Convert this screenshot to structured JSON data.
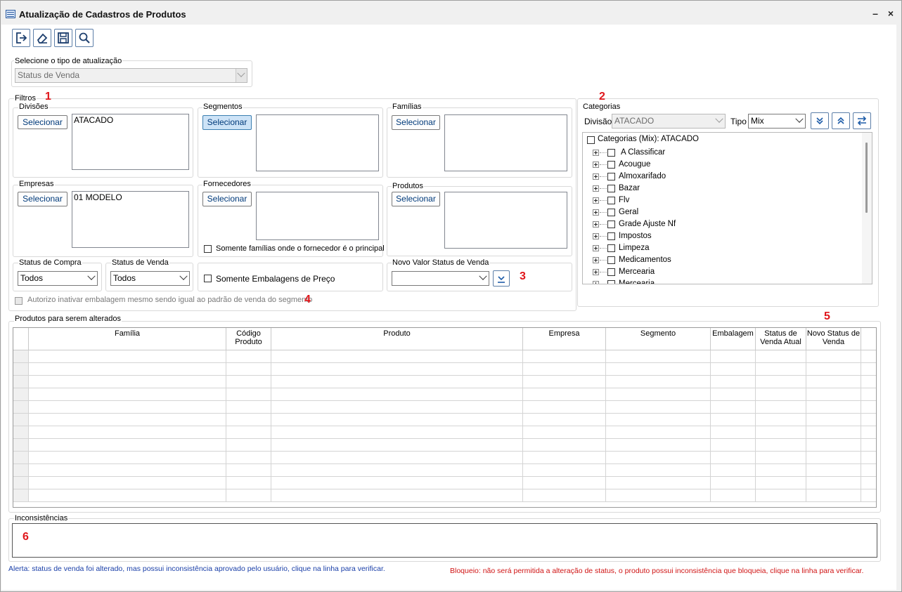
{
  "window": {
    "title": "Atualização de Cadastros de Produtos",
    "minimize": "–",
    "close": "×"
  },
  "toolbar": {
    "exit_icon": "exit-icon",
    "clear_icon": "eraser-icon",
    "save_icon": "save-icon",
    "search_icon": "search-icon"
  },
  "update_type": {
    "label": "Selecione o tipo de atualização",
    "value": "Status de Venda"
  },
  "filters": {
    "label": "Filtros",
    "marker": "1",
    "divisoes": {
      "label": "Divisões",
      "button": "Selecionar",
      "items": "ATACADO"
    },
    "segmentos": {
      "label": "Segmentos",
      "button": "Selecionar",
      "items": ""
    },
    "familias": {
      "label": "Famílias",
      "button": "Selecionar",
      "items": ""
    },
    "empresas": {
      "label": "Empresas",
      "button": "Selecionar",
      "items": "01 MODELO"
    },
    "fornecedores": {
      "label": "Fornecedores",
      "button": "Selecionar",
      "items": "",
      "checkbox": "Somente famílias onde o fornecedor é o principal"
    },
    "produtos": {
      "label": "Produtos",
      "button": "Selecionar",
      "items": ""
    },
    "status_compra": {
      "label": "Status de Compra",
      "value": "Todos"
    },
    "status_venda": {
      "label": "Status de Venda",
      "value": "Todos"
    },
    "embalagens": {
      "checkbox": "Somente Embalagens de Preço"
    },
    "novo_valor": {
      "label": "Novo Valor Status de Venda",
      "value": "",
      "marker": "3"
    },
    "autorizo": {
      "text": "Autorizo inativar embalagem mesmo sendo igual ao padrão de venda do segmento",
      "marker": "4"
    }
  },
  "categorias": {
    "label": "Categorias",
    "marker": "2",
    "divisao_label": "Divisão",
    "divisao_value": "ATACADO",
    "tipo_label": "Tipo",
    "tipo_value": "Mix",
    "root": "Categorias (Mix): ATACADO",
    "items": [
      "A Classificar",
      "Acougue",
      "Almoxarifado",
      "Bazar",
      "Flv",
      "Geral",
      "Grade Ajuste Nf",
      "Impostos",
      "Limpeza",
      "Medicamentos",
      "Mercearia",
      "Mercearia"
    ]
  },
  "produtos_grid": {
    "label": "Produtos para serem alterados",
    "marker": "5",
    "columns": [
      "Família",
      "Código Produto",
      "Produto",
      "Empresa",
      "Segmento",
      "Embalagem",
      "Status de Venda Atual",
      "Novo Status de Venda"
    ]
  },
  "inconsistencias": {
    "label": "Inconsistências",
    "marker": "6"
  },
  "footer": {
    "alerta": "Alerta: status de venda foi alterado, mas possui inconsistência aprovado pelo usuário, clique na linha para verificar.",
    "bloqueio": "Bloqueio: não será permitida a alteração de status, o produto possui inconsistência que bloqueia, clique na linha para verificar."
  },
  "colors": {
    "accent": "#3c7fb1",
    "marker": "#e0161b",
    "alerta": "#1a3fa8",
    "bloqueio": "#d01515"
  }
}
